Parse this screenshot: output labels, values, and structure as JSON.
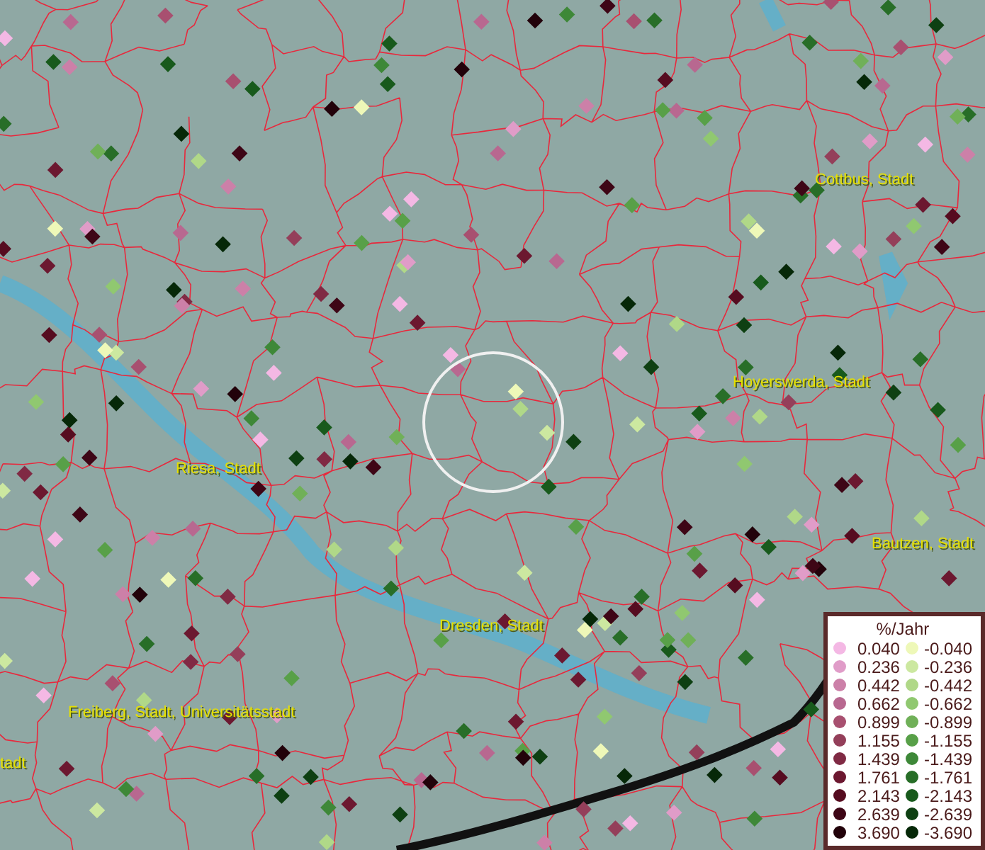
{
  "map": {
    "place_labels": [
      "Cottbus, Stadt",
      "Hoyerswerda, Stadt",
      "Riesa, Stadt",
      "Bautzen, Stadt",
      "Dresden, Stadt",
      "Freiberg, Stadt, Universitätsstadt",
      "tadt"
    ]
  },
  "legend": {
    "title": "%/Jahr",
    "positive": [
      {
        "label": "0.040",
        "color": "#f4b8e4"
      },
      {
        "label": "0.236",
        "color": "#e09cc8"
      },
      {
        "label": "0.442",
        "color": "#cc80a8"
      },
      {
        "label": "0.662",
        "color": "#b86890"
      },
      {
        "label": "0.899",
        "color": "#a85070"
      },
      {
        "label": "1.155",
        "color": "#943f5a"
      },
      {
        "label": "1.439",
        "color": "#802a44"
      },
      {
        "label": "1.761",
        "color": "#6c1830"
      },
      {
        "label": "2.143",
        "color": "#560c20"
      },
      {
        "label": "2.639",
        "color": "#3e0616"
      },
      {
        "label": "3.690",
        "color": "#22020a"
      }
    ],
    "negative": [
      {
        "label": "-0.040",
        "color": "#eef8b8"
      },
      {
        "label": "-0.236",
        "color": "#cce8a0"
      },
      {
        "label": "-0.442",
        "color": "#b0d888"
      },
      {
        "label": "-0.662",
        "color": "#90c870"
      },
      {
        "label": "-0.899",
        "color": "#70b058"
      },
      {
        "label": "-1.155",
        "color": "#58a048"
      },
      {
        "label": "-1.439",
        "color": "#3e8838"
      },
      {
        "label": "-1.761",
        "color": "#286e28"
      },
      {
        "label": "-2.143",
        "color": "#185a1c"
      },
      {
        "label": "-2.639",
        "color": "#0e4012"
      },
      {
        "label": "-3.690",
        "color": "#062808"
      }
    ]
  }
}
